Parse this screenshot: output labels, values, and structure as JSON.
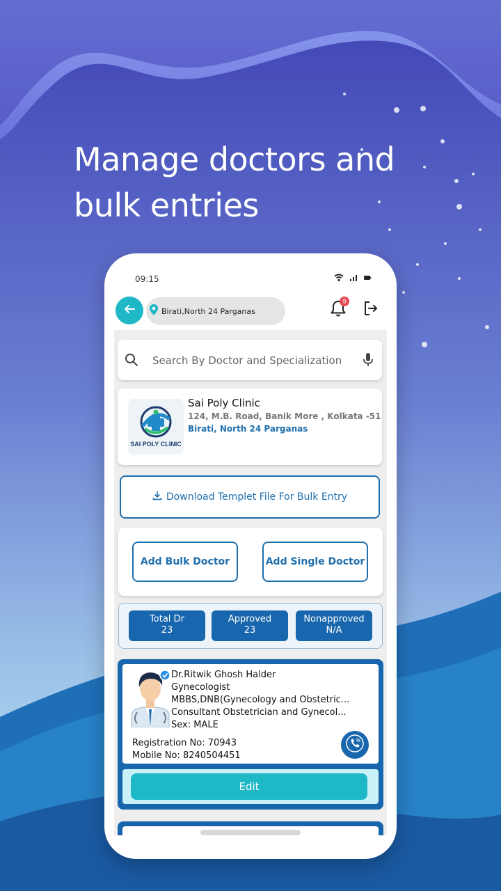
{
  "headline": "Manage doctors and bulk entries",
  "phone": {
    "status_time": "09:15",
    "location": "Birati,North 24 Parganas",
    "notification_count": "9"
  },
  "search": {
    "placeholder": "Search By Doctor and Specialization"
  },
  "clinic": {
    "name": "Sai Poly Clinic",
    "address": "124, M.B. Road, Banik More , Kolkata -51",
    "city": "Birati, North 24 Parganas",
    "logo_text": "SAI POLY CLINIC"
  },
  "download_label": "Download Templet File For Bulk Entry",
  "add_bulk_label": "Add Bulk Doctor",
  "add_single_label": "Add Single Doctor",
  "stats": [
    {
      "label": "Total Dr",
      "value": "23"
    },
    {
      "label": "Approved",
      "value": "23"
    },
    {
      "label": "Nonapproved",
      "value": "N/A"
    }
  ],
  "doctor": {
    "name": "Dr.Ritwik Ghosh Halder",
    "specialty": "Gynecologist",
    "degree": "MBBS,DNB(Gynecology and Obstetric...",
    "designation": "Consultant Obstetrician and Gynecol...",
    "sex": "Sex: MALE",
    "registration": "Registration No: 70943",
    "mobile": "Mobile No: 8240504451",
    "edit_label": "Edit"
  },
  "colors": {
    "primary_blue": "#1866ad",
    "teal": "#1fb8c6",
    "badge_red": "#e44b55"
  }
}
